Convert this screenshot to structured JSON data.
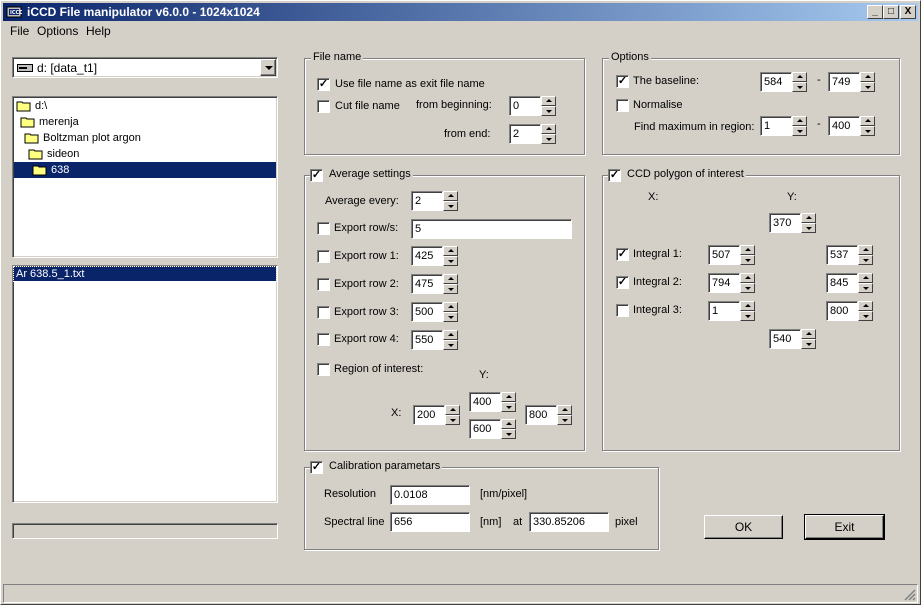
{
  "window": {
    "title": "iCCD File manipulator v6.0.0 - 1024x1024",
    "min": "_",
    "max": "□",
    "close": "X"
  },
  "menu": {
    "file": "File",
    "options": "Options",
    "help": "Help"
  },
  "drive": {
    "value": "d: [data_t1]"
  },
  "tree": {
    "items": [
      {
        "label": "d:\\"
      },
      {
        "label": "merenja"
      },
      {
        "label": "Boltzman plot argon"
      },
      {
        "label": "sideon"
      },
      {
        "label": "638"
      }
    ]
  },
  "filelist": {
    "items": [
      {
        "label": "Ar 638.5_1.txt"
      }
    ]
  },
  "filename": {
    "title": "File name",
    "use_label": "Use file name as exit file name",
    "use_checked": "✓",
    "cut_label": "Cut file name",
    "cut_checked": "",
    "from_begin_label": "from beginning:",
    "from_begin": "0",
    "from_end_label": "from end:",
    "from_end": "2"
  },
  "options": {
    "title": "Options",
    "baseline_label": "The baseline:",
    "baseline_checked": "✓",
    "baseline_from": "584",
    "baseline_to": "749",
    "dash": "-",
    "normalise_label": "Normalise",
    "normalise_checked": "",
    "findmax_label": "Find maximum in region:",
    "findmax_from": "1",
    "findmax_to": "400"
  },
  "average": {
    "title": "Average settings",
    "title_checked": "✓",
    "every_label": "Average every:",
    "every": "2",
    "exrows_label": "Export row/s:",
    "exrows": "5",
    "row1_label": "Export row 1:",
    "row1": "425",
    "row2_label": "Export row 2:",
    "row2": "475",
    "row3_label": "Export row 3:",
    "row3": "500",
    "row4_label": "Export row 4:",
    "row4": "550",
    "roi_label": "Region of interest:",
    "x_label": "X:",
    "y_label": "Y:",
    "x1": "200",
    "y1": "400",
    "y2": "600",
    "x2": "800"
  },
  "ccd": {
    "title": "CCD polygon of interest",
    "title_checked": "✓",
    "x_label": "X:",
    "y_label": "Y:",
    "top": "370",
    "int1_label": "Integral 1:",
    "int1_checked": "✓",
    "int1_a": "507",
    "int1_b": "537",
    "int2_label": "Integral 2:",
    "int2_checked": "✓",
    "int2_a": "794",
    "int2_b": "845",
    "int3_label": "Integral 3:",
    "int3_checked": "",
    "int3_a": "1",
    "int3_b": "800",
    "bottom": "540"
  },
  "calib": {
    "title": "Calibration parametars",
    "title_checked": "✓",
    "res_label": "Resolution",
    "res": "0.0108",
    "res_unit": "[nm/pixel]",
    "spec_label": "Spectral line",
    "spec": "656",
    "spec_unit": "[nm]",
    "at_label": "at",
    "pixel_val": "330.85206",
    "pixel_label": "pixel"
  },
  "buttons": {
    "ok": "OK",
    "exit": "Exit"
  }
}
